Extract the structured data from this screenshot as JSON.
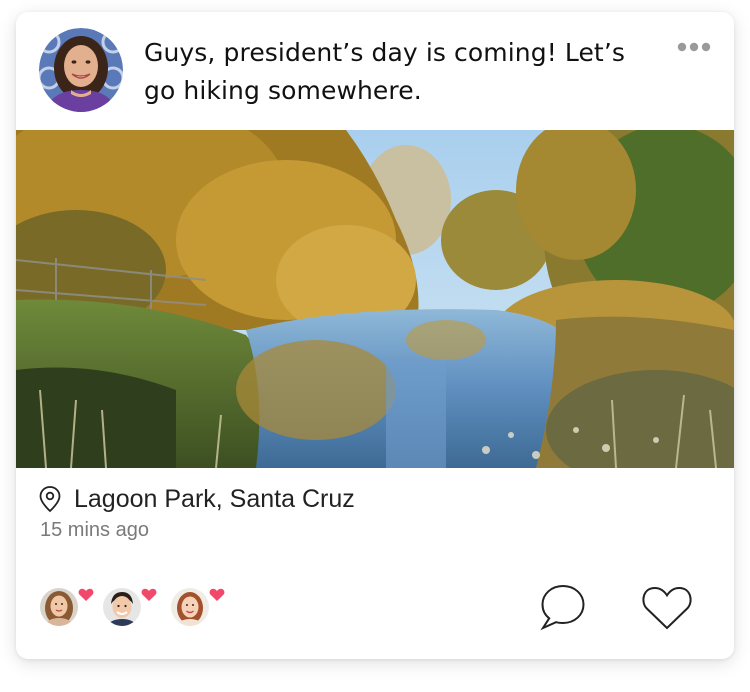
{
  "post": {
    "text": "Guys, president’s day is coming! Let’s go hiking somewhere.",
    "location": "Lagoon Park, Santa Cruz",
    "time_ago": "15 mins ago"
  },
  "author": {
    "avatar_icon": "user-avatar"
  },
  "likers": [
    {
      "avatar_icon": "liker-avatar-girl"
    },
    {
      "avatar_icon": "liker-avatar-boy"
    },
    {
      "avatar_icon": "liker-avatar-redhead"
    }
  ],
  "colors": {
    "heart_badge": "#f2496a",
    "text_primary": "#111111",
    "text_secondary": "#7a7a7a",
    "icon_stroke": "#222222",
    "more_dots": "#9a9a9a"
  },
  "icons": {
    "more": "more-horizontal-icon",
    "location": "map-pin-icon",
    "comment": "speech-bubble-icon",
    "like": "heart-outline-icon"
  }
}
